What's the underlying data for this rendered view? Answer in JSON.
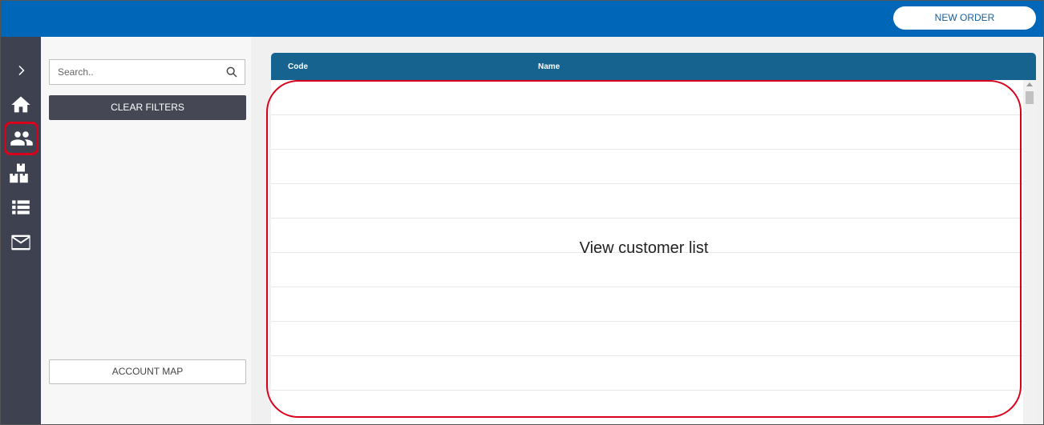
{
  "header": {
    "new_order_label": "NEW ORDER"
  },
  "nav": {
    "items": [
      {
        "name": "expand",
        "icon": "chevron-right-icon"
      },
      {
        "name": "home",
        "icon": "home-icon"
      },
      {
        "name": "customers",
        "icon": "people-icon",
        "active": true
      },
      {
        "name": "products",
        "icon": "boxes-icon"
      },
      {
        "name": "list",
        "icon": "list-icon"
      },
      {
        "name": "messages",
        "icon": "mail-icon"
      }
    ]
  },
  "filters": {
    "search_placeholder": "Search..",
    "clear_label": "CLEAR FILTERS",
    "account_map_label": "ACCOUNT MAP"
  },
  "table": {
    "columns": [
      "Code",
      "Name"
    ]
  },
  "annotation": {
    "text": "View customer list",
    "color": "#d9001b"
  },
  "colors": {
    "topbar": "#0067b8",
    "nav_bg": "#3e4150",
    "table_header": "#16638f"
  }
}
